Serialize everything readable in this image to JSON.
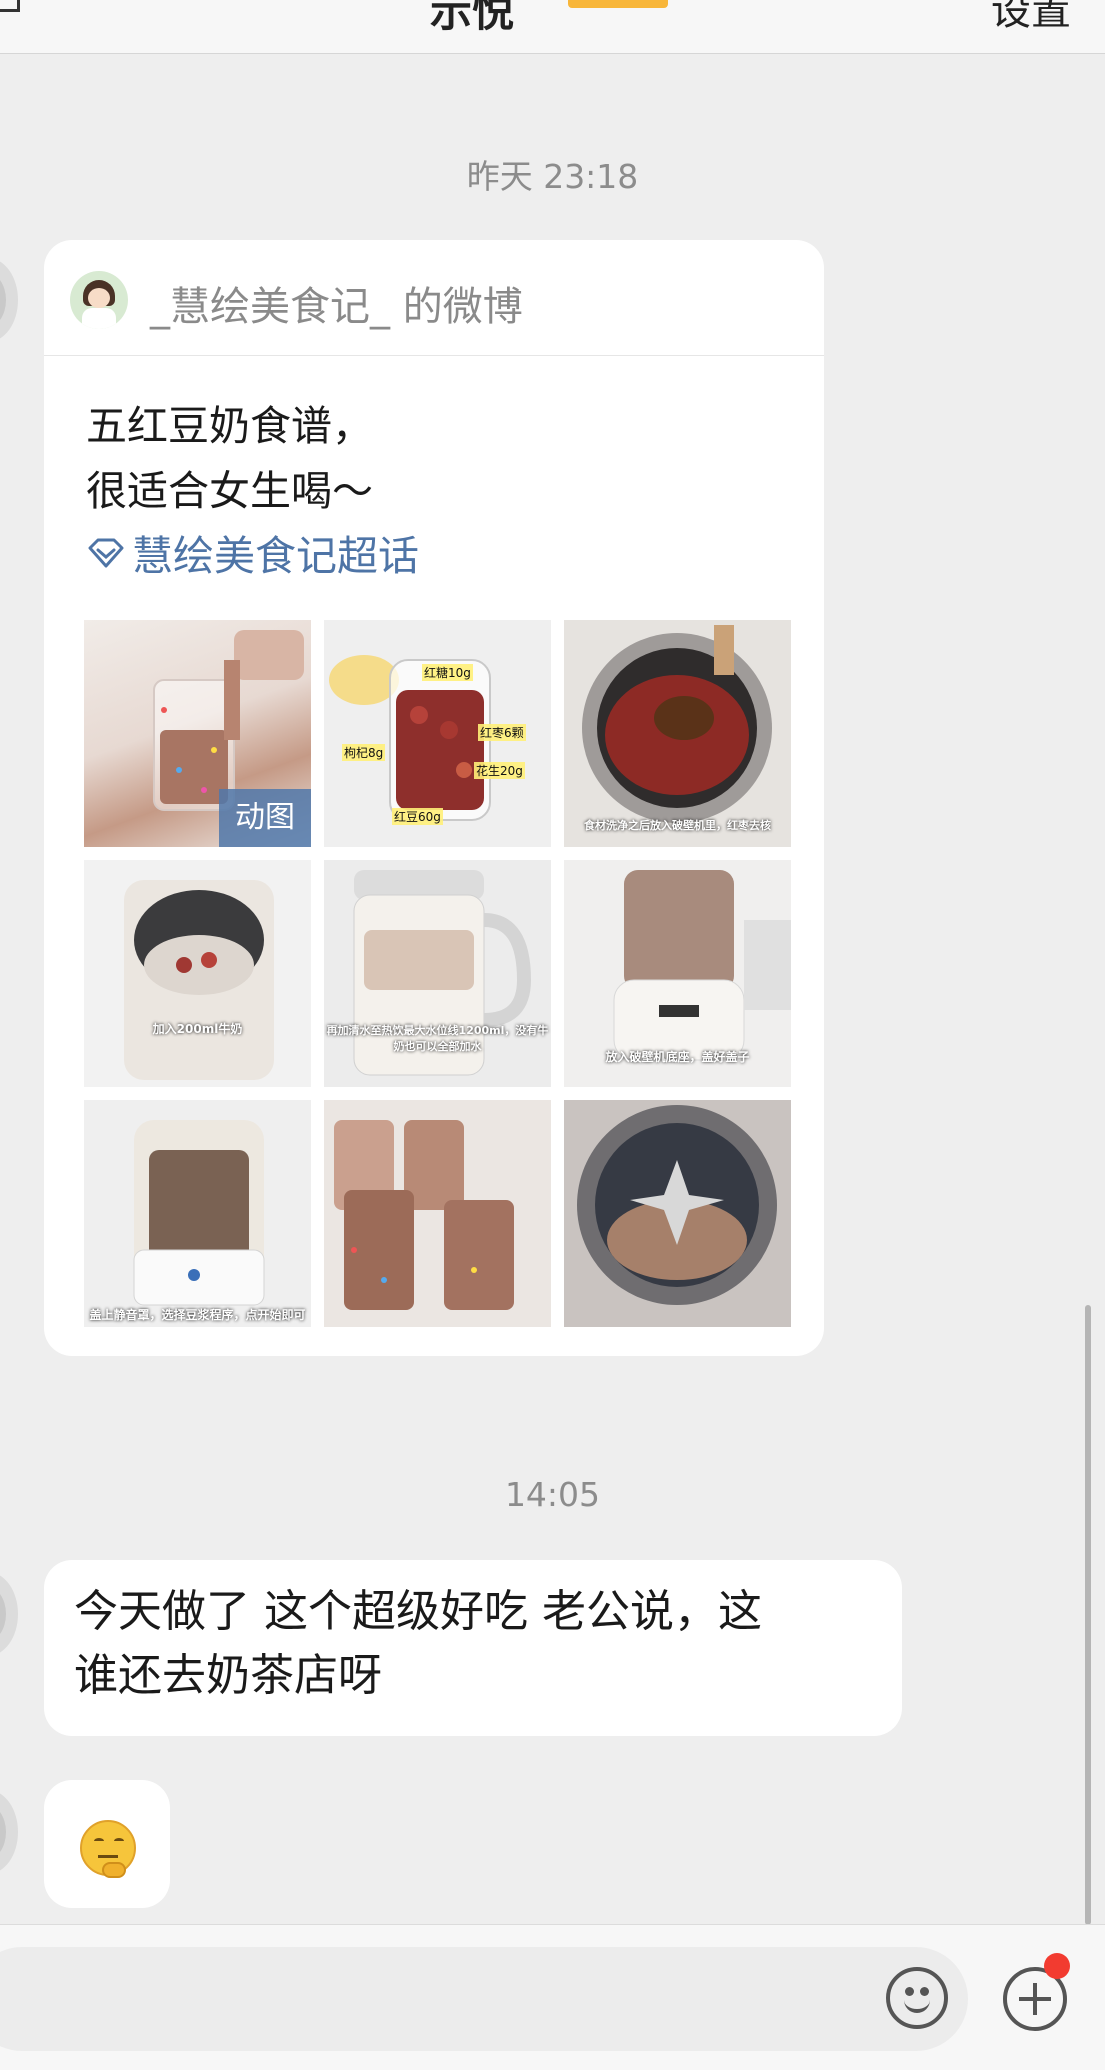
{
  "header": {
    "title": "示悦",
    "settings_label": "设置"
  },
  "timestamps": [
    "昨天 23:18",
    "14:05"
  ],
  "shared_post": {
    "source": "_慧绘美食记_ 的微博",
    "text_lines": [
      "五红豆奶食谱，",
      "很适合女生喝～"
    ],
    "topic": "慧绘美食记超话",
    "gif_badge": "动图",
    "image_captions": {
      "img2_labels": [
        "红糖10g",
        "红枣6颗",
        "枸杞8g",
        "花生20g",
        "红豆60g"
      ],
      "img3": "食材洗净之后放入破壁机里，红枣去核",
      "img4": "加入200ml牛奶",
      "img5": "再加清水至热饮最大水位线1200ml，没有牛奶也可以全部加水",
      "img6": "放入破壁机底座，盖好盖子",
      "img7": "盖上静音罩，选择豆浆程序，点开始即可"
    },
    "watermark": "慧绘美食记"
  },
  "messages": [
    {
      "lines": [
        "今天做了 这个超级好吃 老公说，这",
        "谁还去奶茶店呀"
      ]
    }
  ],
  "input": {
    "placeholder": ""
  },
  "colors": {
    "accent": "#4e74a6",
    "badge": "#f23b30"
  }
}
